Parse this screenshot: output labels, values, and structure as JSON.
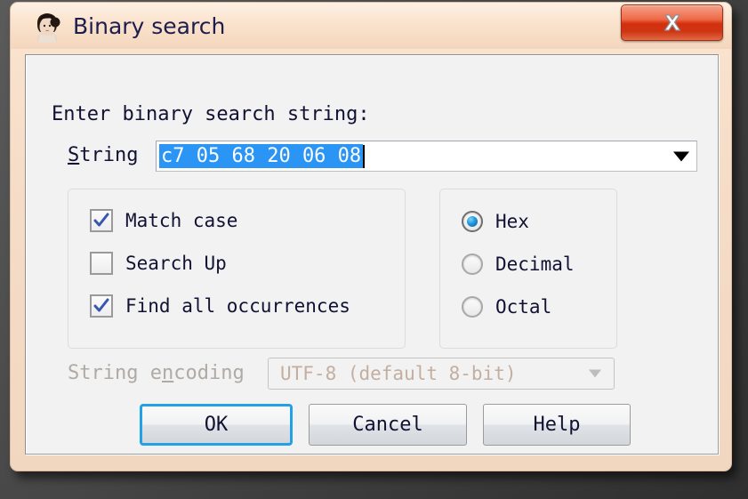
{
  "window": {
    "title": "Binary search",
    "icon": "portrait-avatar-icon",
    "close_label": "X"
  },
  "dialog": {
    "prompt": "Enter binary search string:",
    "string_field": {
      "label": "String",
      "label_accel": "S",
      "label_rest": "tring",
      "value": "c7 05 68 20 06 08",
      "selected": true,
      "dropdown_icon": "chevron-down-icon"
    },
    "options_group": {
      "items": [
        {
          "label": "Match case",
          "checked": true
        },
        {
          "label": "Search Up",
          "checked": false
        },
        {
          "label": "Find all occurrences",
          "checked": true
        }
      ]
    },
    "base_group": {
      "items": [
        {
          "label": "Hex",
          "selected": true
        },
        {
          "label": "Decimal",
          "selected": false
        },
        {
          "label": "Octal",
          "selected": false
        }
      ]
    },
    "encoding": {
      "label_pre": "String e",
      "label_accel": "n",
      "label_post": "coding",
      "value": "UTF-8 (default 8-bit)",
      "disabled": true,
      "dropdown_icon": "chevron-down-icon"
    },
    "buttons": {
      "ok": "OK",
      "cancel": "Cancel",
      "help": "Help"
    }
  },
  "colors": {
    "titlebar": "#f7dcc4",
    "close_red": "#d42f0d",
    "selection_blue": "#2a95f5",
    "focus_blue": "#22a0e8",
    "content_bg": "#f2f2f2",
    "disabled_text": "#c3aea0"
  }
}
